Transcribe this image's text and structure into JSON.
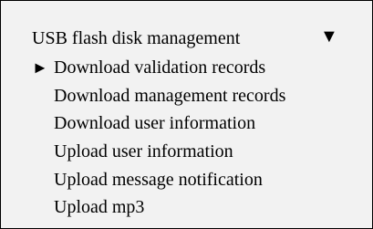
{
  "menu": {
    "title": "USB flash disk management",
    "scroll_indicator": "▼",
    "selection_pointer": "►",
    "items": [
      {
        "label": "Download validation records"
      },
      {
        "label": "Download management records"
      },
      {
        "label": "Download user information"
      },
      {
        "label": "Upload user information"
      },
      {
        "label": "Upload message notification"
      },
      {
        "label": "Upload mp3"
      }
    ],
    "selected_index": 0
  }
}
